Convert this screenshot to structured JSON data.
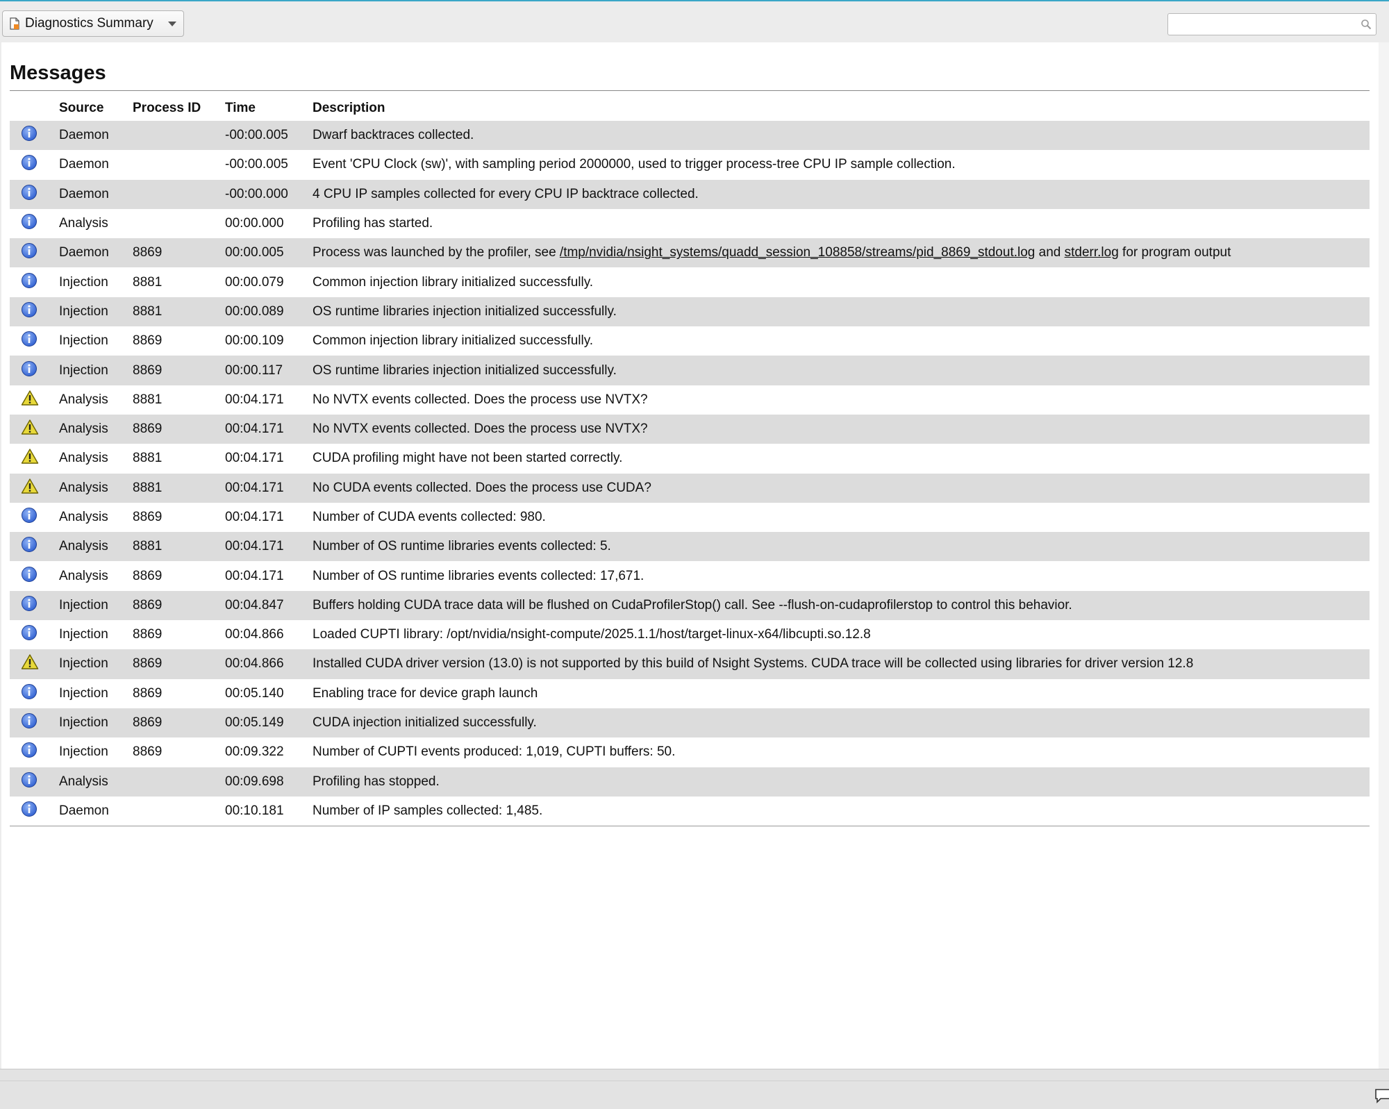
{
  "toolbar": {
    "view_label": "Diagnostics Summary",
    "search_value": "",
    "search_placeholder": ""
  },
  "messages": {
    "title": "Messages",
    "columns": {
      "source": "Source",
      "pid": "Process ID",
      "time": "Time",
      "description": "Description"
    },
    "rows": [
      {
        "level": "info",
        "source": "Daemon",
        "pid": "",
        "time": "-00:00.005",
        "description": "Dwarf backtraces collected."
      },
      {
        "level": "info",
        "source": "Daemon",
        "pid": "",
        "time": "-00:00.005",
        "description": "Event 'CPU Clock (sw)', with sampling period 2000000, used to trigger process-tree CPU IP sample collection."
      },
      {
        "level": "info",
        "source": "Daemon",
        "pid": "",
        "time": "-00:00.000",
        "description": "4 CPU IP samples collected for every CPU IP backtrace collected."
      },
      {
        "level": "info",
        "source": "Analysis",
        "pid": "",
        "time": "00:00.000",
        "description": "Profiling has started."
      },
      {
        "level": "info",
        "source": "Daemon",
        "pid": "8869",
        "time": "00:00.005",
        "description": "",
        "desc_parts": {
          "pre": "Process was launched by the profiler, see ",
          "link1": "/tmp/nvidia/nsight_systems/quadd_session_108858/streams/pid_8869_stdout.log",
          "mid": " and ",
          "link2": "stderr.log",
          "post": " for program output"
        }
      },
      {
        "level": "info",
        "source": "Injection",
        "pid": "8881",
        "time": "00:00.079",
        "description": "Common injection library initialized successfully."
      },
      {
        "level": "info",
        "source": "Injection",
        "pid": "8881",
        "time": "00:00.089",
        "description": "OS runtime libraries injection initialized successfully."
      },
      {
        "level": "info",
        "source": "Injection",
        "pid": "8869",
        "time": "00:00.109",
        "description": "Common injection library initialized successfully."
      },
      {
        "level": "info",
        "source": "Injection",
        "pid": "8869",
        "time": "00:00.117",
        "description": "OS runtime libraries injection initialized successfully."
      },
      {
        "level": "warning",
        "source": "Analysis",
        "pid": "8881",
        "time": "00:04.171",
        "description": "No NVTX events collected. Does the process use NVTX?"
      },
      {
        "level": "warning",
        "source": "Analysis",
        "pid": "8869",
        "time": "00:04.171",
        "description": "No NVTX events collected. Does the process use NVTX?"
      },
      {
        "level": "warning",
        "source": "Analysis",
        "pid": "8881",
        "time": "00:04.171",
        "description": "CUDA profiling might have not been started correctly."
      },
      {
        "level": "warning",
        "source": "Analysis",
        "pid": "8881",
        "time": "00:04.171",
        "description": "No CUDA events collected. Does the process use CUDA?"
      },
      {
        "level": "info",
        "source": "Analysis",
        "pid": "8869",
        "time": "00:04.171",
        "description": "Number of CUDA events collected: 980."
      },
      {
        "level": "info",
        "source": "Analysis",
        "pid": "8881",
        "time": "00:04.171",
        "description": "Number of OS runtime libraries events collected: 5."
      },
      {
        "level": "info",
        "source": "Analysis",
        "pid": "8869",
        "time": "00:04.171",
        "description": "Number of OS runtime libraries events collected: 17,671."
      },
      {
        "level": "info",
        "source": "Injection",
        "pid": "8869",
        "time": "00:04.847",
        "description": "Buffers holding CUDA trace data will be flushed on CudaProfilerStop() call. See --flush-on-cudaprofilerstop to control this behavior."
      },
      {
        "level": "info",
        "source": "Injection",
        "pid": "8869",
        "time": "00:04.866",
        "description": "Loaded CUPTI library: /opt/nvidia/nsight-compute/2025.1.1/host/target-linux-x64/libcupti.so.12.8"
      },
      {
        "level": "warning",
        "source": "Injection",
        "pid": "8869",
        "time": "00:04.866",
        "description": "Installed CUDA driver version (13.0) is not supported by this build of Nsight Systems. CUDA trace will be collected using libraries for driver version 12.8"
      },
      {
        "level": "info",
        "source": "Injection",
        "pid": "8869",
        "time": "00:05.140",
        "description": "Enabling trace for device graph launch"
      },
      {
        "level": "info",
        "source": "Injection",
        "pid": "8869",
        "time": "00:05.149",
        "description": "CUDA injection initialized successfully."
      },
      {
        "level": "info",
        "source": "Injection",
        "pid": "8869",
        "time": "00:09.322",
        "description": "Number of CUPTI events produced: 1,019, CUPTI buffers: 50."
      },
      {
        "level": "info",
        "source": "Analysis",
        "pid": "",
        "time": "00:09.698",
        "description": "Profiling has stopped."
      },
      {
        "level": "info",
        "source": "Daemon",
        "pid": "",
        "time": "00:10.181",
        "description": "Number of IP samples collected: 1,485."
      }
    ]
  },
  "icons": {
    "info": "info-icon",
    "warning": "warning-icon",
    "view": "document-icon",
    "search": "magnifier-icon",
    "feedback": "chat-bubble-icon"
  },
  "colors": {
    "accent": "#3aa7c7",
    "info": "#2f5fd0",
    "warning": "#e8d93a",
    "row_alt": "#dcdcdc"
  }
}
